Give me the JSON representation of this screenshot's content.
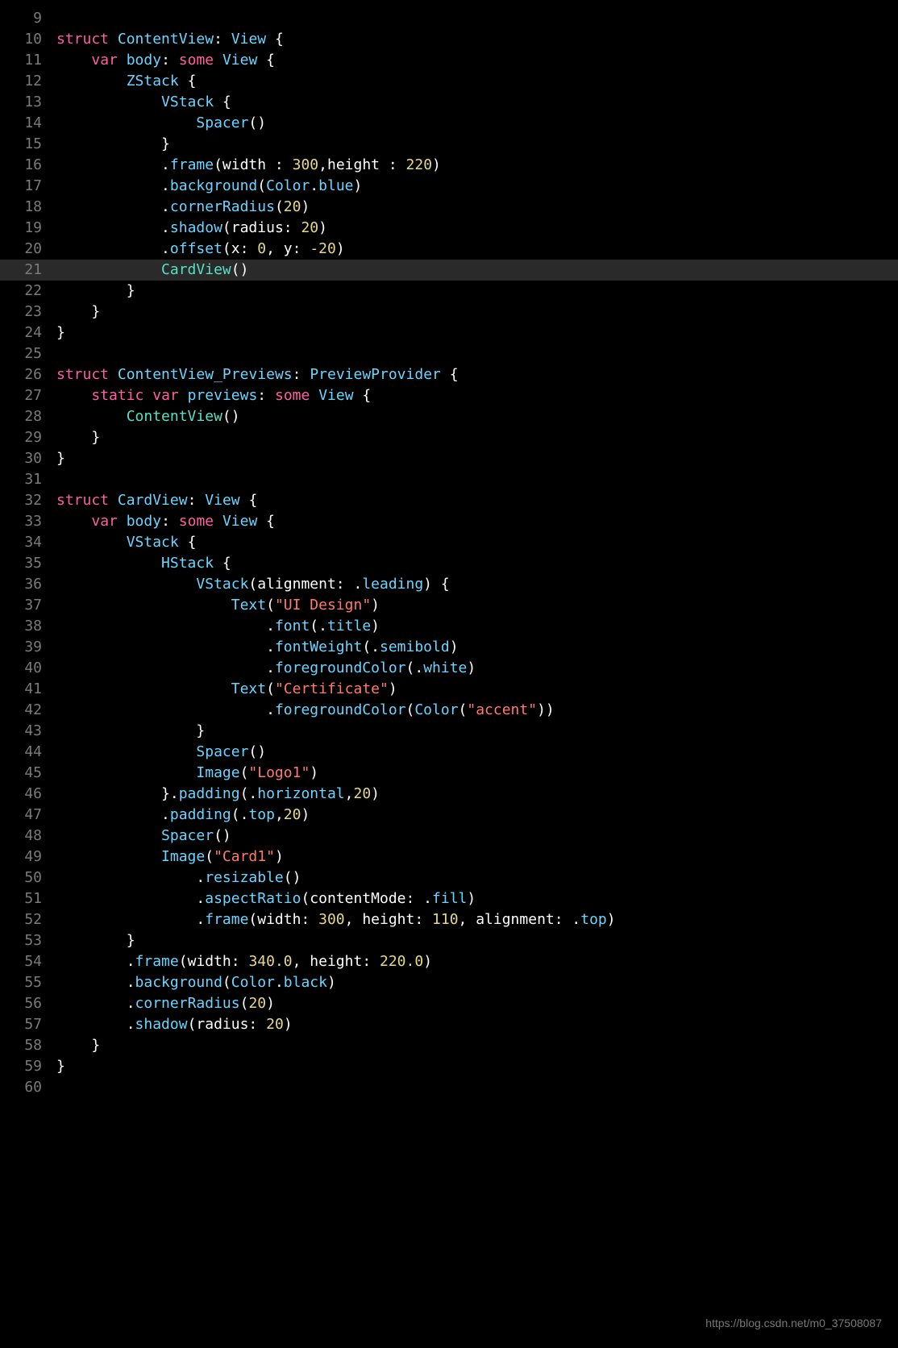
{
  "watermark": "https://blog.csdn.net/m0_37508087",
  "lines": [
    {
      "num": "9",
      "hl": false,
      "tokens": []
    },
    {
      "num": "10",
      "hl": false,
      "tokens": [
        [
          "kw",
          "struct"
        ],
        [
          "id",
          " "
        ],
        [
          "type",
          "ContentView"
        ],
        [
          "id",
          ": "
        ],
        [
          "type",
          "View"
        ],
        [
          "id",
          " {"
        ]
      ]
    },
    {
      "num": "11",
      "hl": false,
      "tokens": [
        [
          "id",
          "    "
        ],
        [
          "kw",
          "var"
        ],
        [
          "id",
          " "
        ],
        [
          "type",
          "body"
        ],
        [
          "id",
          ": "
        ],
        [
          "kw",
          "some"
        ],
        [
          "id",
          " "
        ],
        [
          "type",
          "View"
        ],
        [
          "id",
          " {"
        ]
      ]
    },
    {
      "num": "12",
      "hl": false,
      "tokens": [
        [
          "id",
          "        "
        ],
        [
          "type",
          "ZStack"
        ],
        [
          "id",
          " {"
        ]
      ]
    },
    {
      "num": "13",
      "hl": false,
      "tokens": [
        [
          "id",
          "            "
        ],
        [
          "type",
          "VStack"
        ],
        [
          "id",
          " {"
        ]
      ]
    },
    {
      "num": "14",
      "hl": false,
      "tokens": [
        [
          "id",
          "                "
        ],
        [
          "type",
          "Spacer"
        ],
        [
          "id",
          "()"
        ]
      ]
    },
    {
      "num": "15",
      "hl": false,
      "tokens": [
        [
          "id",
          "            }"
        ]
      ]
    },
    {
      "num": "16",
      "hl": false,
      "tokens": [
        [
          "id",
          "            ."
        ],
        [
          "type",
          "frame"
        ],
        [
          "id",
          "(width : "
        ],
        [
          "num",
          "300"
        ],
        [
          "id",
          ",height : "
        ],
        [
          "num",
          "220"
        ],
        [
          "id",
          ")"
        ]
      ]
    },
    {
      "num": "17",
      "hl": false,
      "tokens": [
        [
          "id",
          "            ."
        ],
        [
          "type",
          "background"
        ],
        [
          "id",
          "("
        ],
        [
          "type",
          "Color"
        ],
        [
          "id",
          "."
        ],
        [
          "type",
          "blue"
        ],
        [
          "id",
          ")"
        ]
      ]
    },
    {
      "num": "18",
      "hl": false,
      "tokens": [
        [
          "id",
          "            ."
        ],
        [
          "type",
          "cornerRadius"
        ],
        [
          "id",
          "("
        ],
        [
          "num",
          "20"
        ],
        [
          "id",
          ")"
        ]
      ]
    },
    {
      "num": "19",
      "hl": false,
      "tokens": [
        [
          "id",
          "            ."
        ],
        [
          "type",
          "shadow"
        ],
        [
          "id",
          "(radius: "
        ],
        [
          "num",
          "20"
        ],
        [
          "id",
          ")"
        ]
      ]
    },
    {
      "num": "20",
      "hl": false,
      "tokens": [
        [
          "id",
          "            ."
        ],
        [
          "type",
          "offset"
        ],
        [
          "id",
          "(x: "
        ],
        [
          "num",
          "0"
        ],
        [
          "id",
          ", y: "
        ],
        [
          "num",
          "-20"
        ],
        [
          "id",
          ")"
        ]
      ]
    },
    {
      "num": "21",
      "hl": true,
      "tokens": [
        [
          "id",
          "            "
        ],
        [
          "decl",
          "CardView"
        ],
        [
          "id",
          "()"
        ]
      ]
    },
    {
      "num": "22",
      "hl": false,
      "tokens": [
        [
          "id",
          "        }"
        ]
      ]
    },
    {
      "num": "23",
      "hl": false,
      "tokens": [
        [
          "id",
          "    }"
        ]
      ]
    },
    {
      "num": "24",
      "hl": false,
      "tokens": [
        [
          "id",
          "}"
        ]
      ]
    },
    {
      "num": "25",
      "hl": false,
      "tokens": []
    },
    {
      "num": "26",
      "hl": false,
      "tokens": [
        [
          "kw",
          "struct"
        ],
        [
          "id",
          " "
        ],
        [
          "type",
          "ContentView_Previews"
        ],
        [
          "id",
          ": "
        ],
        [
          "type",
          "PreviewProvider"
        ],
        [
          "id",
          " {"
        ]
      ]
    },
    {
      "num": "27",
      "hl": false,
      "tokens": [
        [
          "id",
          "    "
        ],
        [
          "kw",
          "static"
        ],
        [
          "id",
          " "
        ],
        [
          "kw",
          "var"
        ],
        [
          "id",
          " "
        ],
        [
          "type",
          "previews"
        ],
        [
          "id",
          ": "
        ],
        [
          "kw",
          "some"
        ],
        [
          "id",
          " "
        ],
        [
          "type",
          "View"
        ],
        [
          "id",
          " {"
        ]
      ]
    },
    {
      "num": "28",
      "hl": false,
      "tokens": [
        [
          "id",
          "        "
        ],
        [
          "decl",
          "ContentView"
        ],
        [
          "id",
          "()"
        ]
      ]
    },
    {
      "num": "29",
      "hl": false,
      "tokens": [
        [
          "id",
          "    }"
        ]
      ]
    },
    {
      "num": "30",
      "hl": false,
      "tokens": [
        [
          "id",
          "}"
        ]
      ]
    },
    {
      "num": "31",
      "hl": false,
      "tokens": []
    },
    {
      "num": "32",
      "hl": false,
      "tokens": [
        [
          "kw",
          "struct"
        ],
        [
          "id",
          " "
        ],
        [
          "type",
          "CardView"
        ],
        [
          "id",
          ": "
        ],
        [
          "type",
          "View"
        ],
        [
          "id",
          " {"
        ]
      ]
    },
    {
      "num": "33",
      "hl": false,
      "tokens": [
        [
          "id",
          "    "
        ],
        [
          "kw",
          "var"
        ],
        [
          "id",
          " "
        ],
        [
          "type",
          "body"
        ],
        [
          "id",
          ": "
        ],
        [
          "kw",
          "some"
        ],
        [
          "id",
          " "
        ],
        [
          "type",
          "View"
        ],
        [
          "id",
          " {"
        ]
      ]
    },
    {
      "num": "34",
      "hl": false,
      "tokens": [
        [
          "id",
          "        "
        ],
        [
          "type",
          "VStack"
        ],
        [
          "id",
          " {"
        ]
      ]
    },
    {
      "num": "35",
      "hl": false,
      "tokens": [
        [
          "id",
          "            "
        ],
        [
          "type",
          "HStack"
        ],
        [
          "id",
          " {"
        ]
      ]
    },
    {
      "num": "36",
      "hl": false,
      "tokens": [
        [
          "id",
          "                "
        ],
        [
          "type",
          "VStack"
        ],
        [
          "id",
          "(alignment: ."
        ],
        [
          "type",
          "leading"
        ],
        [
          "id",
          ") {"
        ]
      ]
    },
    {
      "num": "37",
      "hl": false,
      "tokens": [
        [
          "id",
          "                    "
        ],
        [
          "type",
          "Text"
        ],
        [
          "id",
          "("
        ],
        [
          "str",
          "\"UI Design\""
        ],
        [
          "id",
          ")"
        ]
      ]
    },
    {
      "num": "38",
      "hl": false,
      "tokens": [
        [
          "id",
          "                        ."
        ],
        [
          "type",
          "font"
        ],
        [
          "id",
          "(."
        ],
        [
          "type",
          "title"
        ],
        [
          "id",
          ")"
        ]
      ]
    },
    {
      "num": "39",
      "hl": false,
      "tokens": [
        [
          "id",
          "                        ."
        ],
        [
          "type",
          "fontWeight"
        ],
        [
          "id",
          "(."
        ],
        [
          "type",
          "semibold"
        ],
        [
          "id",
          ")"
        ]
      ]
    },
    {
      "num": "40",
      "hl": false,
      "tokens": [
        [
          "id",
          "                        ."
        ],
        [
          "type",
          "foregroundColor"
        ],
        [
          "id",
          "(."
        ],
        [
          "type",
          "white"
        ],
        [
          "id",
          ")"
        ]
      ]
    },
    {
      "num": "41",
      "hl": false,
      "tokens": [
        [
          "id",
          "                    "
        ],
        [
          "type",
          "Text"
        ],
        [
          "id",
          "("
        ],
        [
          "str",
          "\"Certificate\""
        ],
        [
          "id",
          ")"
        ]
      ]
    },
    {
      "num": "42",
      "hl": false,
      "tokens": [
        [
          "id",
          "                        ."
        ],
        [
          "type",
          "foregroundColor"
        ],
        [
          "id",
          "("
        ],
        [
          "type",
          "Color"
        ],
        [
          "id",
          "("
        ],
        [
          "str",
          "\"accent\""
        ],
        [
          "id",
          "))"
        ]
      ]
    },
    {
      "num": "43",
      "hl": false,
      "tokens": [
        [
          "id",
          "                }"
        ]
      ]
    },
    {
      "num": "44",
      "hl": false,
      "tokens": [
        [
          "id",
          "                "
        ],
        [
          "type",
          "Spacer"
        ],
        [
          "id",
          "()"
        ]
      ]
    },
    {
      "num": "45",
      "hl": false,
      "tokens": [
        [
          "id",
          "                "
        ],
        [
          "type",
          "Image"
        ],
        [
          "id",
          "("
        ],
        [
          "str",
          "\"Logo1\""
        ],
        [
          "id",
          ")"
        ]
      ]
    },
    {
      "num": "46",
      "hl": false,
      "tokens": [
        [
          "id",
          "            }."
        ],
        [
          "type",
          "padding"
        ],
        [
          "id",
          "(."
        ],
        [
          "type",
          "horizontal"
        ],
        [
          "id",
          ","
        ],
        [
          "num",
          "20"
        ],
        [
          "id",
          ")"
        ]
      ]
    },
    {
      "num": "47",
      "hl": false,
      "tokens": [
        [
          "id",
          "            ."
        ],
        [
          "type",
          "padding"
        ],
        [
          "id",
          "(."
        ],
        [
          "type",
          "top"
        ],
        [
          "id",
          ","
        ],
        [
          "num",
          "20"
        ],
        [
          "id",
          ")"
        ]
      ]
    },
    {
      "num": "48",
      "hl": false,
      "tokens": [
        [
          "id",
          "            "
        ],
        [
          "type",
          "Spacer"
        ],
        [
          "id",
          "()"
        ]
      ]
    },
    {
      "num": "49",
      "hl": false,
      "tokens": [
        [
          "id",
          "            "
        ],
        [
          "type",
          "Image"
        ],
        [
          "id",
          "("
        ],
        [
          "str",
          "\"Card1\""
        ],
        [
          "id",
          ")"
        ]
      ]
    },
    {
      "num": "50",
      "hl": false,
      "tokens": [
        [
          "id",
          "                ."
        ],
        [
          "type",
          "resizable"
        ],
        [
          "id",
          "()"
        ]
      ]
    },
    {
      "num": "51",
      "hl": false,
      "tokens": [
        [
          "id",
          "                ."
        ],
        [
          "type",
          "aspectRatio"
        ],
        [
          "id",
          "(contentMode: ."
        ],
        [
          "type",
          "fill"
        ],
        [
          "id",
          ")"
        ]
      ]
    },
    {
      "num": "52",
      "hl": false,
      "tokens": [
        [
          "id",
          "                ."
        ],
        [
          "type",
          "frame"
        ],
        [
          "id",
          "(width: "
        ],
        [
          "num",
          "300"
        ],
        [
          "id",
          ", height: "
        ],
        [
          "num",
          "110"
        ],
        [
          "id",
          ", alignment: ."
        ],
        [
          "type",
          "top"
        ],
        [
          "id",
          ")"
        ]
      ]
    },
    {
      "num": "53",
      "hl": false,
      "tokens": [
        [
          "id",
          "        }"
        ]
      ]
    },
    {
      "num": "54",
      "hl": false,
      "tokens": [
        [
          "id",
          "        ."
        ],
        [
          "type",
          "frame"
        ],
        [
          "id",
          "(width: "
        ],
        [
          "num",
          "340.0"
        ],
        [
          "id",
          ", height: "
        ],
        [
          "num",
          "220.0"
        ],
        [
          "id",
          ")"
        ]
      ]
    },
    {
      "num": "55",
      "hl": false,
      "tokens": [
        [
          "id",
          "        ."
        ],
        [
          "type",
          "background"
        ],
        [
          "id",
          "("
        ],
        [
          "type",
          "Color"
        ],
        [
          "id",
          "."
        ],
        [
          "type",
          "black"
        ],
        [
          "id",
          ")"
        ]
      ]
    },
    {
      "num": "56",
      "hl": false,
      "tokens": [
        [
          "id",
          "        ."
        ],
        [
          "type",
          "cornerRadius"
        ],
        [
          "id",
          "("
        ],
        [
          "num",
          "20"
        ],
        [
          "id",
          ")"
        ]
      ]
    },
    {
      "num": "57",
      "hl": false,
      "tokens": [
        [
          "id",
          "        ."
        ],
        [
          "type",
          "shadow"
        ],
        [
          "id",
          "(radius: "
        ],
        [
          "num",
          "20"
        ],
        [
          "id",
          ")"
        ]
      ]
    },
    {
      "num": "58",
      "hl": false,
      "tokens": [
        [
          "id",
          "    }"
        ]
      ]
    },
    {
      "num": "59",
      "hl": false,
      "tokens": [
        [
          "id",
          "}"
        ]
      ]
    },
    {
      "num": "60",
      "hl": false,
      "tokens": []
    }
  ]
}
